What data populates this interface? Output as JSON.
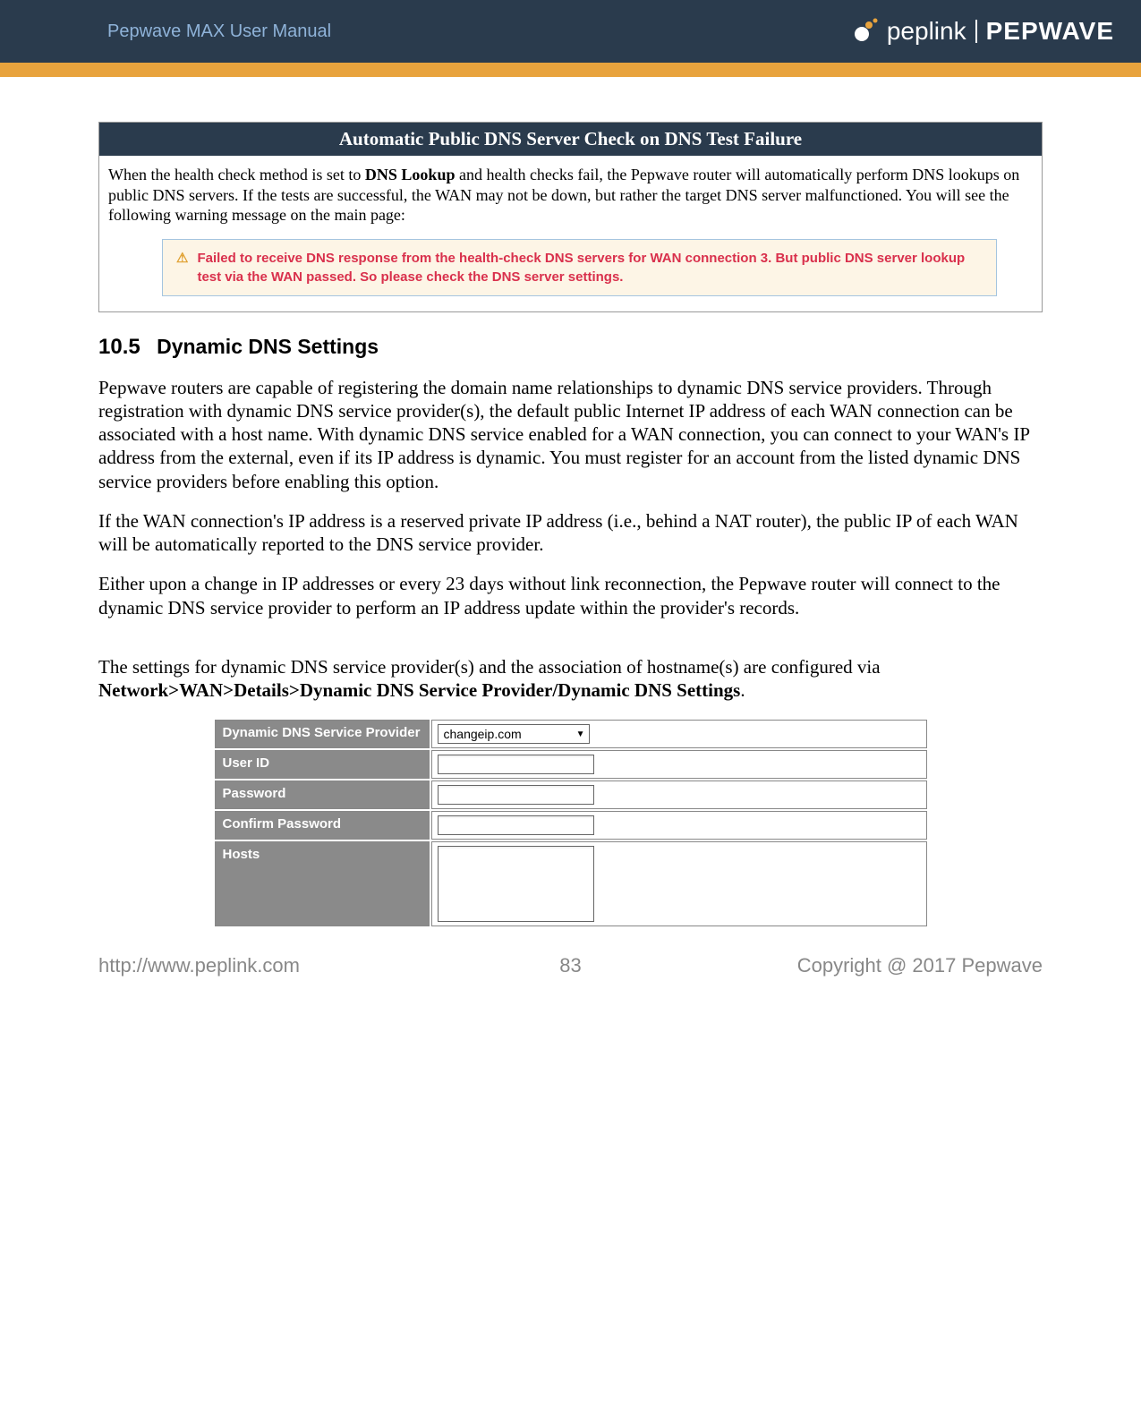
{
  "header": {
    "manual_title": "Pepwave MAX User Manual",
    "brand1": "peplink",
    "brand2": "PEPWAVE"
  },
  "infobox": {
    "title": "Automatic Public DNS Server Check on DNS Test Failure",
    "text_before": "When the health check method is set to ",
    "text_bold": "DNS Lookup",
    "text_after": " and health checks fail, the Pepwave router will automatically perform DNS lookups on public DNS servers. If the tests are successful, the WAN may not be down, but rather the target DNS server malfunctioned. You will see the following warning message on the main page:",
    "warning": "Failed to receive DNS response from the health-check DNS servers for WAN connection 3. But public DNS server lookup test via the WAN passed. So please check the DNS server settings."
  },
  "section": {
    "number": "10.5",
    "title": "Dynamic DNS Settings"
  },
  "paragraphs": {
    "p1": "Pepwave routers are capable of registering the domain name relationships to dynamic DNS service providers. Through registration with dynamic DNS service provider(s), the default public Internet IP address of each WAN connection can be associated with a host name. With dynamic DNS service enabled for a WAN connection, you can connect to your WAN's IP address from the external, even if its IP address is dynamic. You must register for an account from the listed dynamic DNS service providers before enabling this option.",
    "p2": "If the WAN connection's IP address is a reserved private IP address (i.e., behind a NAT router), the public IP of each WAN will be automatically reported to the DNS service provider.",
    "p3": "Either upon a change in IP addresses or every 23 days without link reconnection, the Pepwave router will connect to the dynamic DNS service provider to perform an IP address update within the provider's records.",
    "p4_before": "The settings for dynamic DNS service provider(s) and the association of hostname(s) are configured via ",
    "p4_bold": "Network>WAN>Details>Dynamic DNS Service Provider/Dynamic DNS Settings",
    "p4_after": "."
  },
  "table": {
    "rows": [
      {
        "label": "Dynamic DNS Service Provider",
        "type": "select",
        "value": "changeip.com"
      },
      {
        "label": "User ID",
        "type": "input"
      },
      {
        "label": "Password",
        "type": "input"
      },
      {
        "label": "Confirm Password",
        "type": "input"
      },
      {
        "label": "Hosts",
        "type": "textarea"
      }
    ]
  },
  "footer": {
    "url": "http://www.peplink.com",
    "page": "83",
    "copyright": "Copyright @ 2017 Pepwave"
  }
}
